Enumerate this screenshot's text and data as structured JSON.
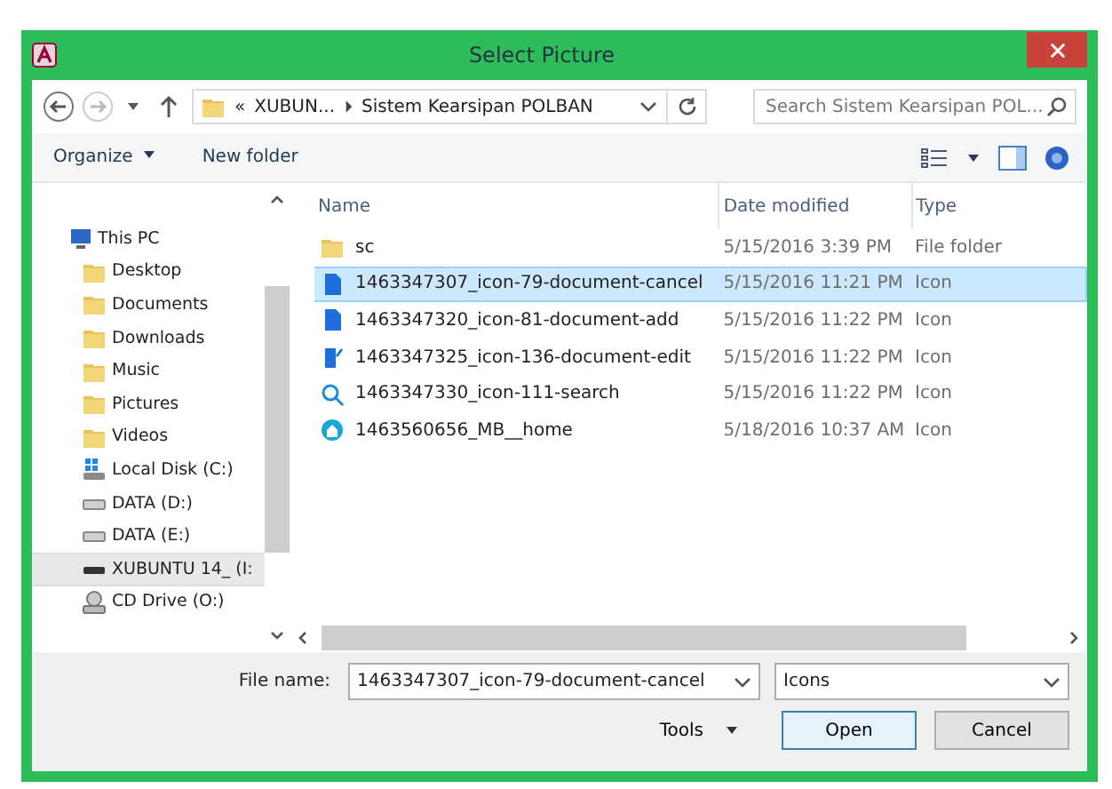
{
  "window": {
    "title": "Select Picture"
  },
  "address": {
    "crumbs": [
      "«",
      "XUBUN...",
      "Sistem Kearsipan POLBAN"
    ]
  },
  "search": {
    "placeholder": "Search Sistem Kearsipan POL..."
  },
  "commands": {
    "organize": "Organize",
    "new_folder": "New folder"
  },
  "sidebar": {
    "items": [
      {
        "label": "This PC",
        "kind": "pc",
        "selected": false,
        "children": [
          {
            "label": "Desktop",
            "kind": "folder",
            "selected": false
          },
          {
            "label": "Documents",
            "kind": "folder",
            "selected": false
          },
          {
            "label": "Downloads",
            "kind": "folder",
            "selected": false
          },
          {
            "label": "Music",
            "kind": "folder",
            "selected": false
          },
          {
            "label": "Pictures",
            "kind": "folder",
            "selected": false
          },
          {
            "label": "Videos",
            "kind": "folder",
            "selected": false
          },
          {
            "label": "Local Disk (C:)",
            "kind": "disk",
            "selected": false
          },
          {
            "label": "DATA (D:)",
            "kind": "drive",
            "selected": false
          },
          {
            "label": "DATA (E:)",
            "kind": "drive",
            "selected": false
          },
          {
            "label": "XUBUNTU 14_ (I:",
            "kind": "usb",
            "selected": true
          },
          {
            "label": "CD Drive (O:)",
            "kind": "cd",
            "selected": false
          }
        ]
      }
    ]
  },
  "table": {
    "columns": [
      "Name",
      "Date modified",
      "Type"
    ],
    "rows": [
      {
        "name": "sc",
        "date": "5/15/2016 3:39 PM",
        "type": "File folder",
        "kind": "folder",
        "selected": false
      },
      {
        "name": "1463347307_icon-79-document-cancel",
        "date": "5/15/2016 11:21 PM",
        "type": "Icon",
        "kind": "document",
        "selected": true
      },
      {
        "name": "1463347320_icon-81-document-add",
        "date": "5/15/2016 11:22 PM",
        "type": "Icon",
        "kind": "document",
        "selected": false
      },
      {
        "name": "1463347325_icon-136-document-edit",
        "date": "5/15/2016 11:22 PM",
        "type": "Icon",
        "kind": "edit",
        "selected": false
      },
      {
        "name": "1463347330_icon-111-search",
        "date": "5/15/2016 11:22 PM",
        "type": "Icon",
        "kind": "search",
        "selected": false
      },
      {
        "name": "1463560656_MB__home",
        "date": "5/18/2016 10:37 AM",
        "type": "Icon",
        "kind": "home",
        "selected": false
      }
    ]
  },
  "footer": {
    "file_name_label": "File name:",
    "file_name": "1463347307_icon-79-document-cancel",
    "filter": "Icons",
    "tools": "Tools",
    "open": "Open",
    "cancel": "Cancel"
  }
}
